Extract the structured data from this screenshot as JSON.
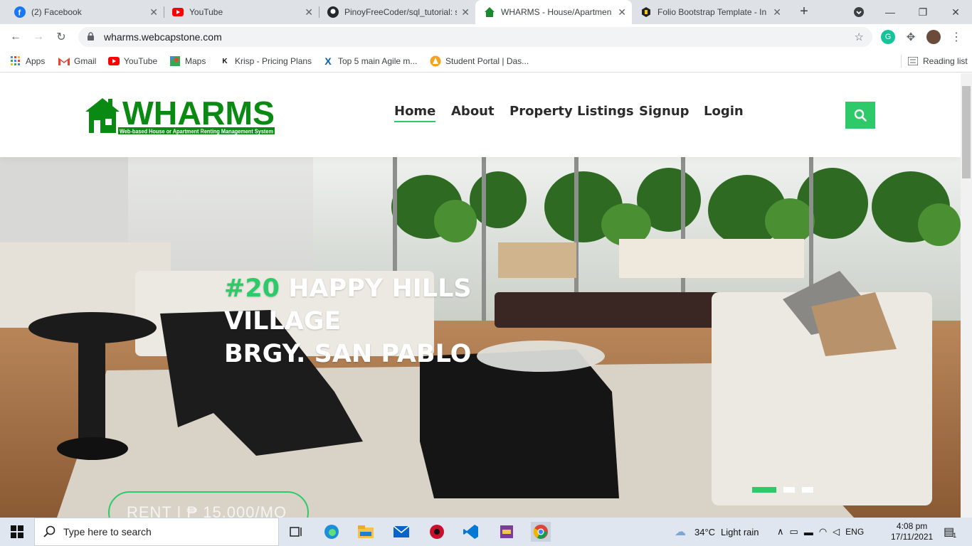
{
  "browser": {
    "tabs": [
      {
        "title": "(2) Facebook",
        "icon": "facebook-icon",
        "color": "#1877f2"
      },
      {
        "title": "YouTube",
        "icon": "youtube-icon",
        "color": "#ff0000"
      },
      {
        "title": "PinoyFreeCoder/sql_tutorial: s",
        "icon": "github-icon",
        "color": "#24292e"
      },
      {
        "title": "WHARMS - House/Apartmen",
        "icon": "house-icon",
        "color": "#1a8a2e",
        "active": true
      },
      {
        "title": "Folio Bootstrap Template - In",
        "icon": "bootstrap-icon",
        "color": "#222222"
      }
    ],
    "url": "wharms.webcapstone.com",
    "bookmarks": [
      {
        "label": "Apps",
        "icon": "apps-grid-icon"
      },
      {
        "label": "Gmail",
        "icon": "gmail-icon"
      },
      {
        "label": "YouTube",
        "icon": "youtube-icon"
      },
      {
        "label": "Maps",
        "icon": "maps-icon"
      },
      {
        "label": "Krisp - Pricing Plans",
        "icon": "krisp-icon"
      },
      {
        "label": "Top 5 main Agile m...",
        "icon": "agile-icon"
      },
      {
        "label": "Student Portal | Das...",
        "icon": "portal-icon"
      }
    ],
    "reading_list": "Reading list",
    "extension_letter": "G"
  },
  "site": {
    "logo_text": "WHARMS",
    "logo_tagline": "Web-based House or Apartment Renting Management System",
    "nav": [
      "Home",
      "About",
      "Property Listings",
      "Signup",
      "Login"
    ],
    "active_nav": "Home",
    "hero": {
      "number": "#20",
      "line1": "HAPPY HILLS",
      "line2": "VILLAGE",
      "line3": "BRGY. SAN PABLO",
      "rent": "RENT | ₱ 15,000/MO"
    },
    "carousel_slides": 3,
    "carousel_active": 1
  },
  "taskbar": {
    "search_placeholder": "Type here to search",
    "weather_temp": "34°C",
    "weather_desc": "Light rain",
    "lang": "ENG",
    "time": "4:08 pm",
    "date": "17/11/2021",
    "notification_count": "1"
  },
  "colors": {
    "accent": "#2eca6a",
    "logo_green": "#0a8a12"
  }
}
